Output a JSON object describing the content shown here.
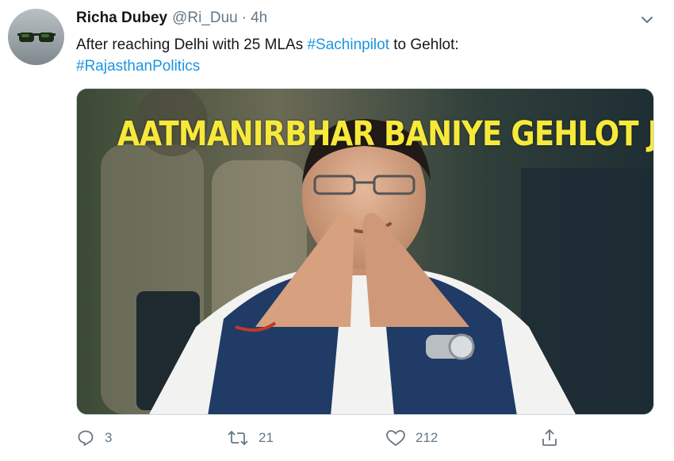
{
  "tweet": {
    "author": {
      "name": "Richa Dubey",
      "handle": "@Ri_Duu",
      "separator": "·",
      "time": "4h"
    },
    "text": {
      "line1_prefix": "After reaching Delhi with 25 MLAs ",
      "hashtag1": "#Sachinpilot",
      "line1_suffix": " to Gehlot:",
      "hashtag2": "#RajasthanPolitics"
    },
    "media": {
      "overlay_text": "AATMANIRBHAR BANIYE GEHLOT JI",
      "overlay_color": "#f7e93a"
    },
    "actions": {
      "reply_count": "3",
      "retweet_count": "21",
      "like_count": "212"
    }
  },
  "colors": {
    "link": "#1b95e0",
    "secondary_text": "#657786",
    "primary_text": "#14171a"
  },
  "icons": [
    "chevron-down-icon",
    "reply-icon",
    "retweet-icon",
    "like-icon",
    "share-icon"
  ]
}
